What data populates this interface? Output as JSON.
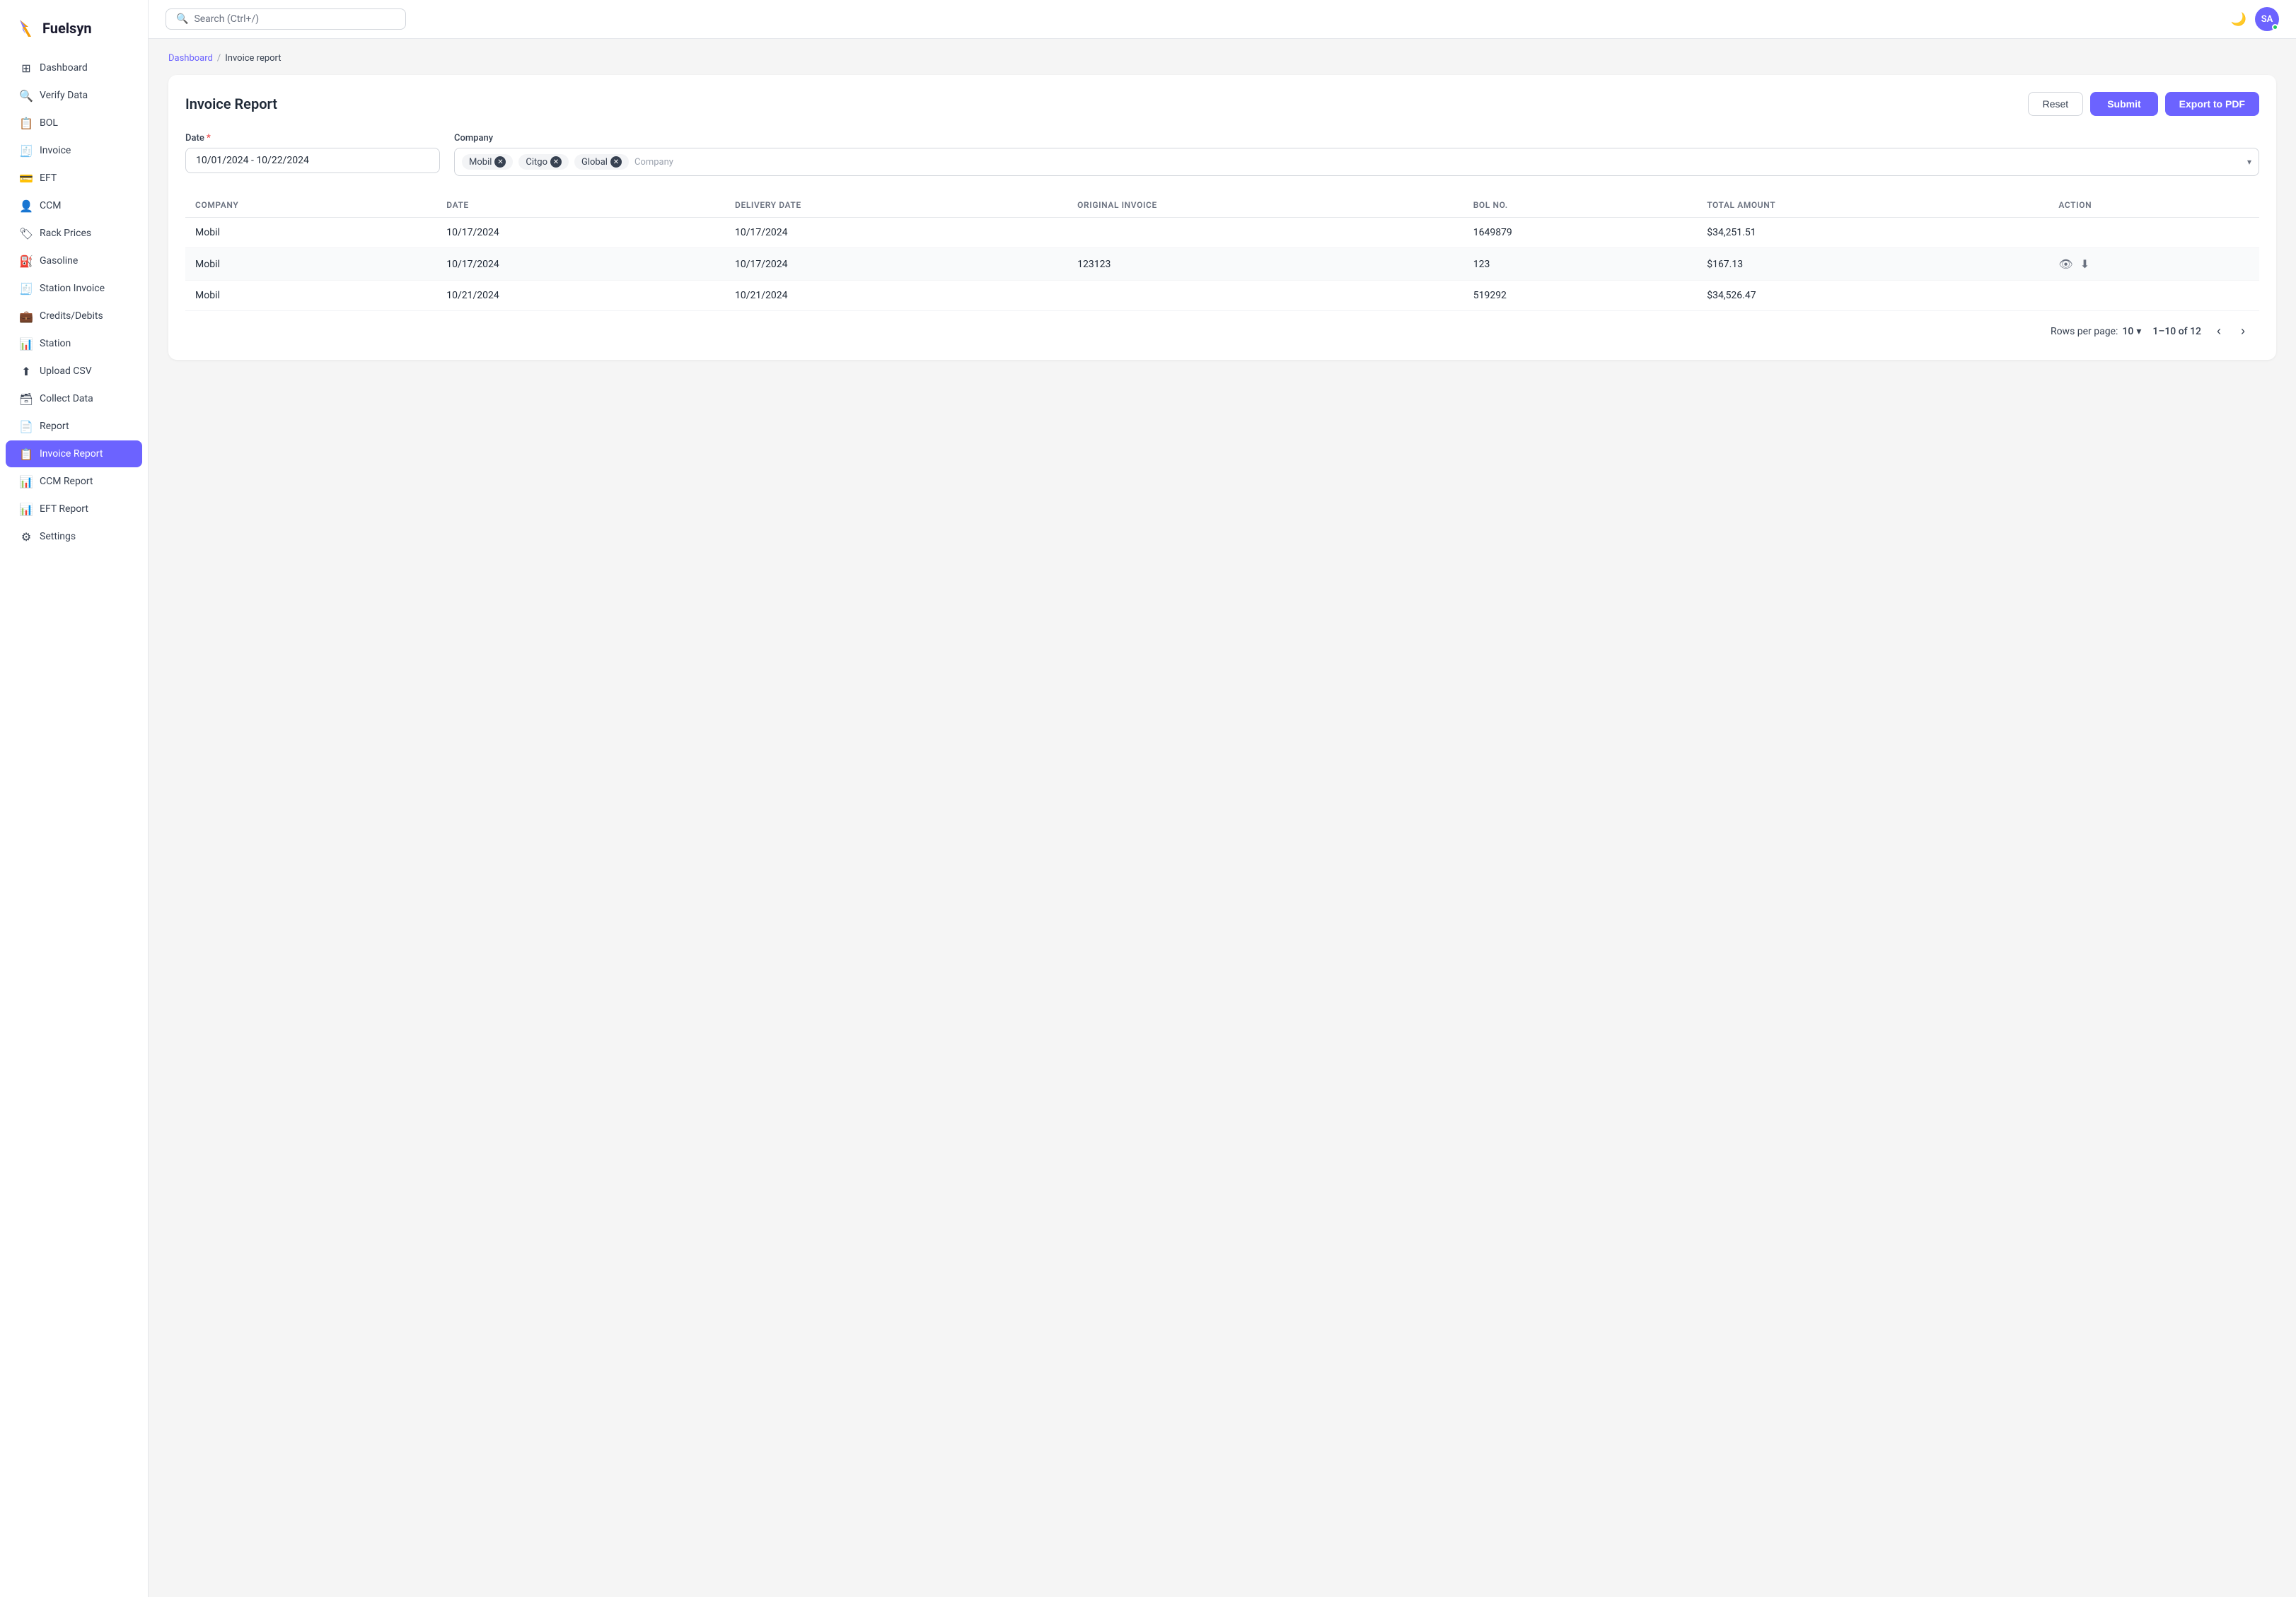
{
  "app": {
    "name": "Fuelsyn"
  },
  "search": {
    "placeholder": "Search (Ctrl+/)"
  },
  "topbar": {
    "avatar_initials": "SA"
  },
  "breadcrumb": {
    "parent": "Dashboard",
    "separator": "/",
    "current": "Invoice report"
  },
  "page": {
    "title": "Invoice Report"
  },
  "buttons": {
    "reset": "Reset",
    "submit": "Submit",
    "export": "Export to PDF"
  },
  "form": {
    "date_label": "Date",
    "date_value": "10/01/2024 - 10/22/2024",
    "company_label": "Company",
    "company_tags": [
      "Mobil",
      "Citgo",
      "Global"
    ],
    "company_placeholder": "Company"
  },
  "table": {
    "columns": [
      "COMPANY",
      "DATE",
      "DELIVERY DATE",
      "ORIGINAL INVOICE",
      "BOL NO.",
      "TOTAL AMOUNT",
      "ACTION"
    ],
    "rows": [
      {
        "company": "Mobil",
        "date": "10/17/2024",
        "delivery_date": "10/17/2024",
        "original_invoice": "",
        "bol_no": "1649879",
        "total_amount": "$34,251.51",
        "has_action": false
      },
      {
        "company": "Mobil",
        "date": "10/17/2024",
        "delivery_date": "10/17/2024",
        "original_invoice": "123123",
        "bol_no": "123",
        "total_amount": "$167.13",
        "has_action": true
      },
      {
        "company": "Mobil",
        "date": "10/21/2024",
        "delivery_date": "10/21/2024",
        "original_invoice": "",
        "bol_no": "519292",
        "total_amount": "$34,526.47",
        "has_action": false
      }
    ]
  },
  "pagination": {
    "rows_per_page_label": "Rows per page:",
    "rows_per_page": "10",
    "page_info": "1–10 of 12"
  },
  "sidebar": {
    "items": [
      {
        "id": "dashboard",
        "label": "Dashboard",
        "icon": "⊞"
      },
      {
        "id": "verify-data",
        "label": "Verify Data",
        "icon": "🔍"
      },
      {
        "id": "bol",
        "label": "BOL",
        "icon": "📋"
      },
      {
        "id": "invoice",
        "label": "Invoice",
        "icon": "🧾"
      },
      {
        "id": "eft",
        "label": "EFT",
        "icon": "💳"
      },
      {
        "id": "ccm",
        "label": "CCM",
        "icon": "👤"
      },
      {
        "id": "rack-prices",
        "label": "Rack Prices",
        "icon": "🏷"
      },
      {
        "id": "gasoline",
        "label": "Gasoline",
        "icon": "⛽"
      },
      {
        "id": "station-invoice",
        "label": "Station Invoice",
        "icon": "🧾"
      },
      {
        "id": "credits-debits",
        "label": "Credits/Debits",
        "icon": "💼"
      },
      {
        "id": "station",
        "label": "Station",
        "icon": "📊"
      },
      {
        "id": "upload-csv",
        "label": "Upload CSV",
        "icon": "⬆"
      },
      {
        "id": "collect-data",
        "label": "Collect Data",
        "icon": "🗃"
      },
      {
        "id": "report",
        "label": "Report",
        "icon": "📄"
      },
      {
        "id": "invoice-report",
        "label": "Invoice Report",
        "icon": "📋",
        "active": true
      },
      {
        "id": "ccm-report",
        "label": "CCM Report",
        "icon": "📊"
      },
      {
        "id": "eft-report",
        "label": "EFT Report",
        "icon": "📊"
      },
      {
        "id": "settings",
        "label": "Settings",
        "icon": "⚙"
      }
    ]
  }
}
